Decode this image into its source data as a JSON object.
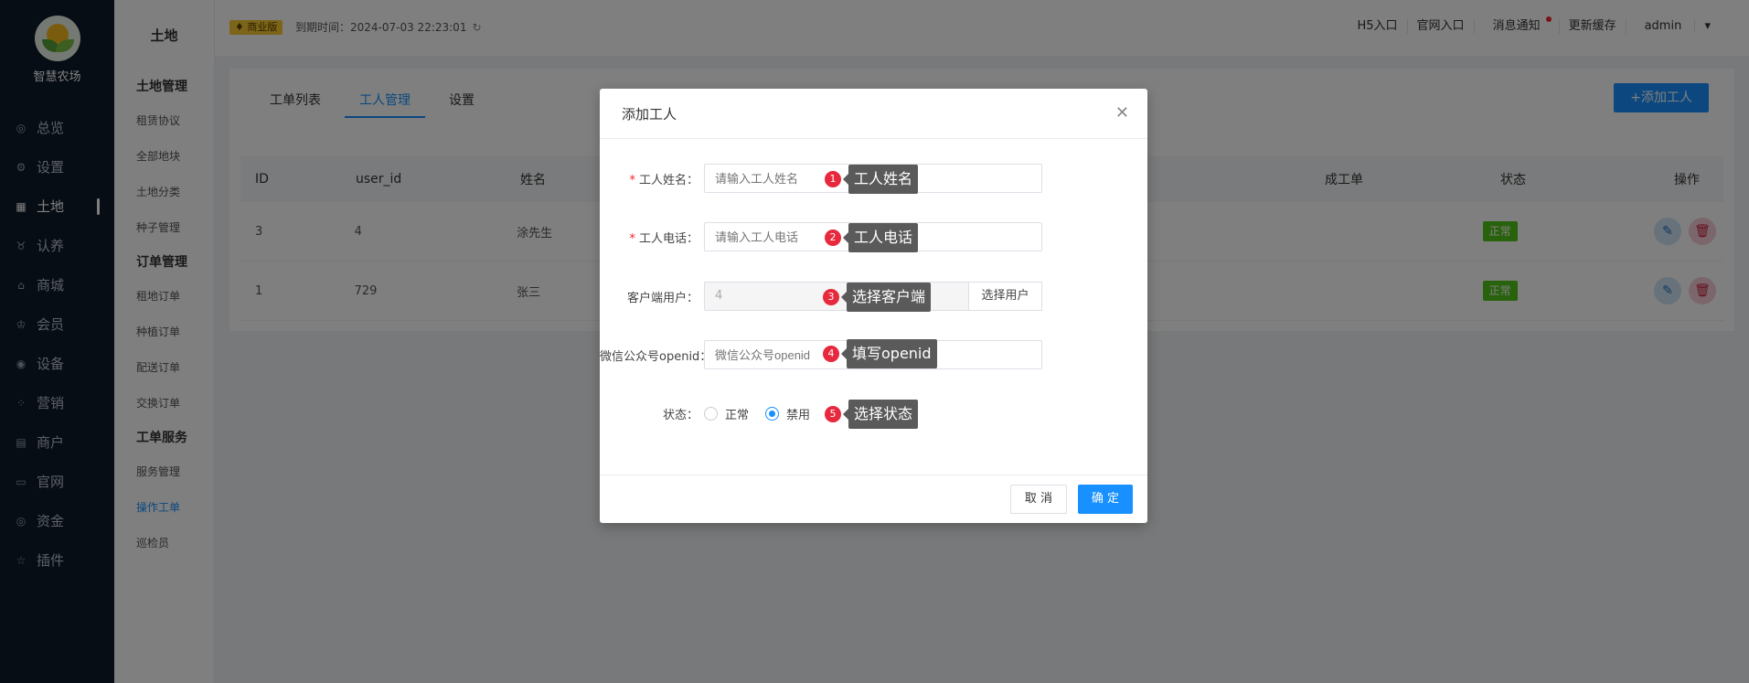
{
  "brand": {
    "name": "智慧农场"
  },
  "sidebar": {
    "items": [
      {
        "label": "总览",
        "icon": "dashboard-icon"
      },
      {
        "label": "设置",
        "icon": "gear-icon"
      },
      {
        "label": "土地",
        "icon": "grid-icon",
        "active": true
      },
      {
        "label": "认养",
        "icon": "paw-icon"
      },
      {
        "label": "商城",
        "icon": "shop-icon"
      },
      {
        "label": "会员",
        "icon": "crown-icon"
      },
      {
        "label": "设备",
        "icon": "location-icon"
      },
      {
        "label": "营销",
        "icon": "apps-icon"
      },
      {
        "label": "商户",
        "icon": "store-icon"
      },
      {
        "label": "官网",
        "icon": "browser-icon"
      },
      {
        "label": "资金",
        "icon": "coin-icon"
      },
      {
        "label": "插件",
        "icon": "star-icon"
      }
    ]
  },
  "submenu": {
    "title": "土地",
    "groups": [
      {
        "title": "土地管理",
        "items": [
          "租赁协议",
          "全部地块",
          "土地分类",
          "种子管理"
        ]
      },
      {
        "title": "订单管理",
        "items": [
          "租地订单",
          "种植订单",
          "配送订单",
          "交换订单"
        ]
      },
      {
        "title": "工单服务",
        "items": [
          "服务管理",
          "操作工单",
          "巡检员"
        ]
      }
    ],
    "active_item": "操作工单"
  },
  "topbar": {
    "badge": "商业版",
    "expire": "到期时间：2024-07-03 22:23:01",
    "links": [
      "H5入口",
      "官网入口",
      "消息通知",
      "更新缓存",
      "admin"
    ]
  },
  "content": {
    "tabs": [
      "工单列表",
      "工人管理",
      "设置"
    ],
    "active_tab": "工人管理",
    "add_button": "+添加工人",
    "table": {
      "headers": [
        "ID",
        "user_id",
        "姓名",
        "成工单",
        "状态",
        "操作"
      ],
      "rows": [
        {
          "id": "3",
          "user_id": "4",
          "name": "涂先生",
          "status": "正常"
        },
        {
          "id": "1",
          "user_id": "729",
          "name": "张三",
          "status": "正常"
        }
      ]
    }
  },
  "dialog": {
    "title": "添加工人",
    "fields": {
      "name": {
        "label": "工人姓名：",
        "placeholder": "请输入工人姓名",
        "required": true
      },
      "phone": {
        "label": "工人电话：",
        "placeholder": "请输入工人电话",
        "required": true
      },
      "client_user": {
        "label": "客户端用户：",
        "value": "4",
        "addon": "选择用户"
      },
      "openid": {
        "label": "微信公众号openid：",
        "placeholder": "微信公众号openid"
      },
      "status": {
        "label": "状态：",
        "options": [
          "正常",
          "禁用"
        ],
        "selected": "禁用"
      }
    },
    "cancel": "取 消",
    "ok": "确 定"
  },
  "annotations": [
    {
      "num": "1",
      "text": "工人姓名"
    },
    {
      "num": "2",
      "text": "工人电话"
    },
    {
      "num": "3",
      "text": "选择客户端"
    },
    {
      "num": "4",
      "text": "填写openid"
    },
    {
      "num": "5",
      "text": "选择状态"
    }
  ],
  "colors": {
    "primary": "#1890ff",
    "sidebar": "#0f1b2b",
    "success": "#52c41a",
    "annotation": "#e8283c"
  }
}
